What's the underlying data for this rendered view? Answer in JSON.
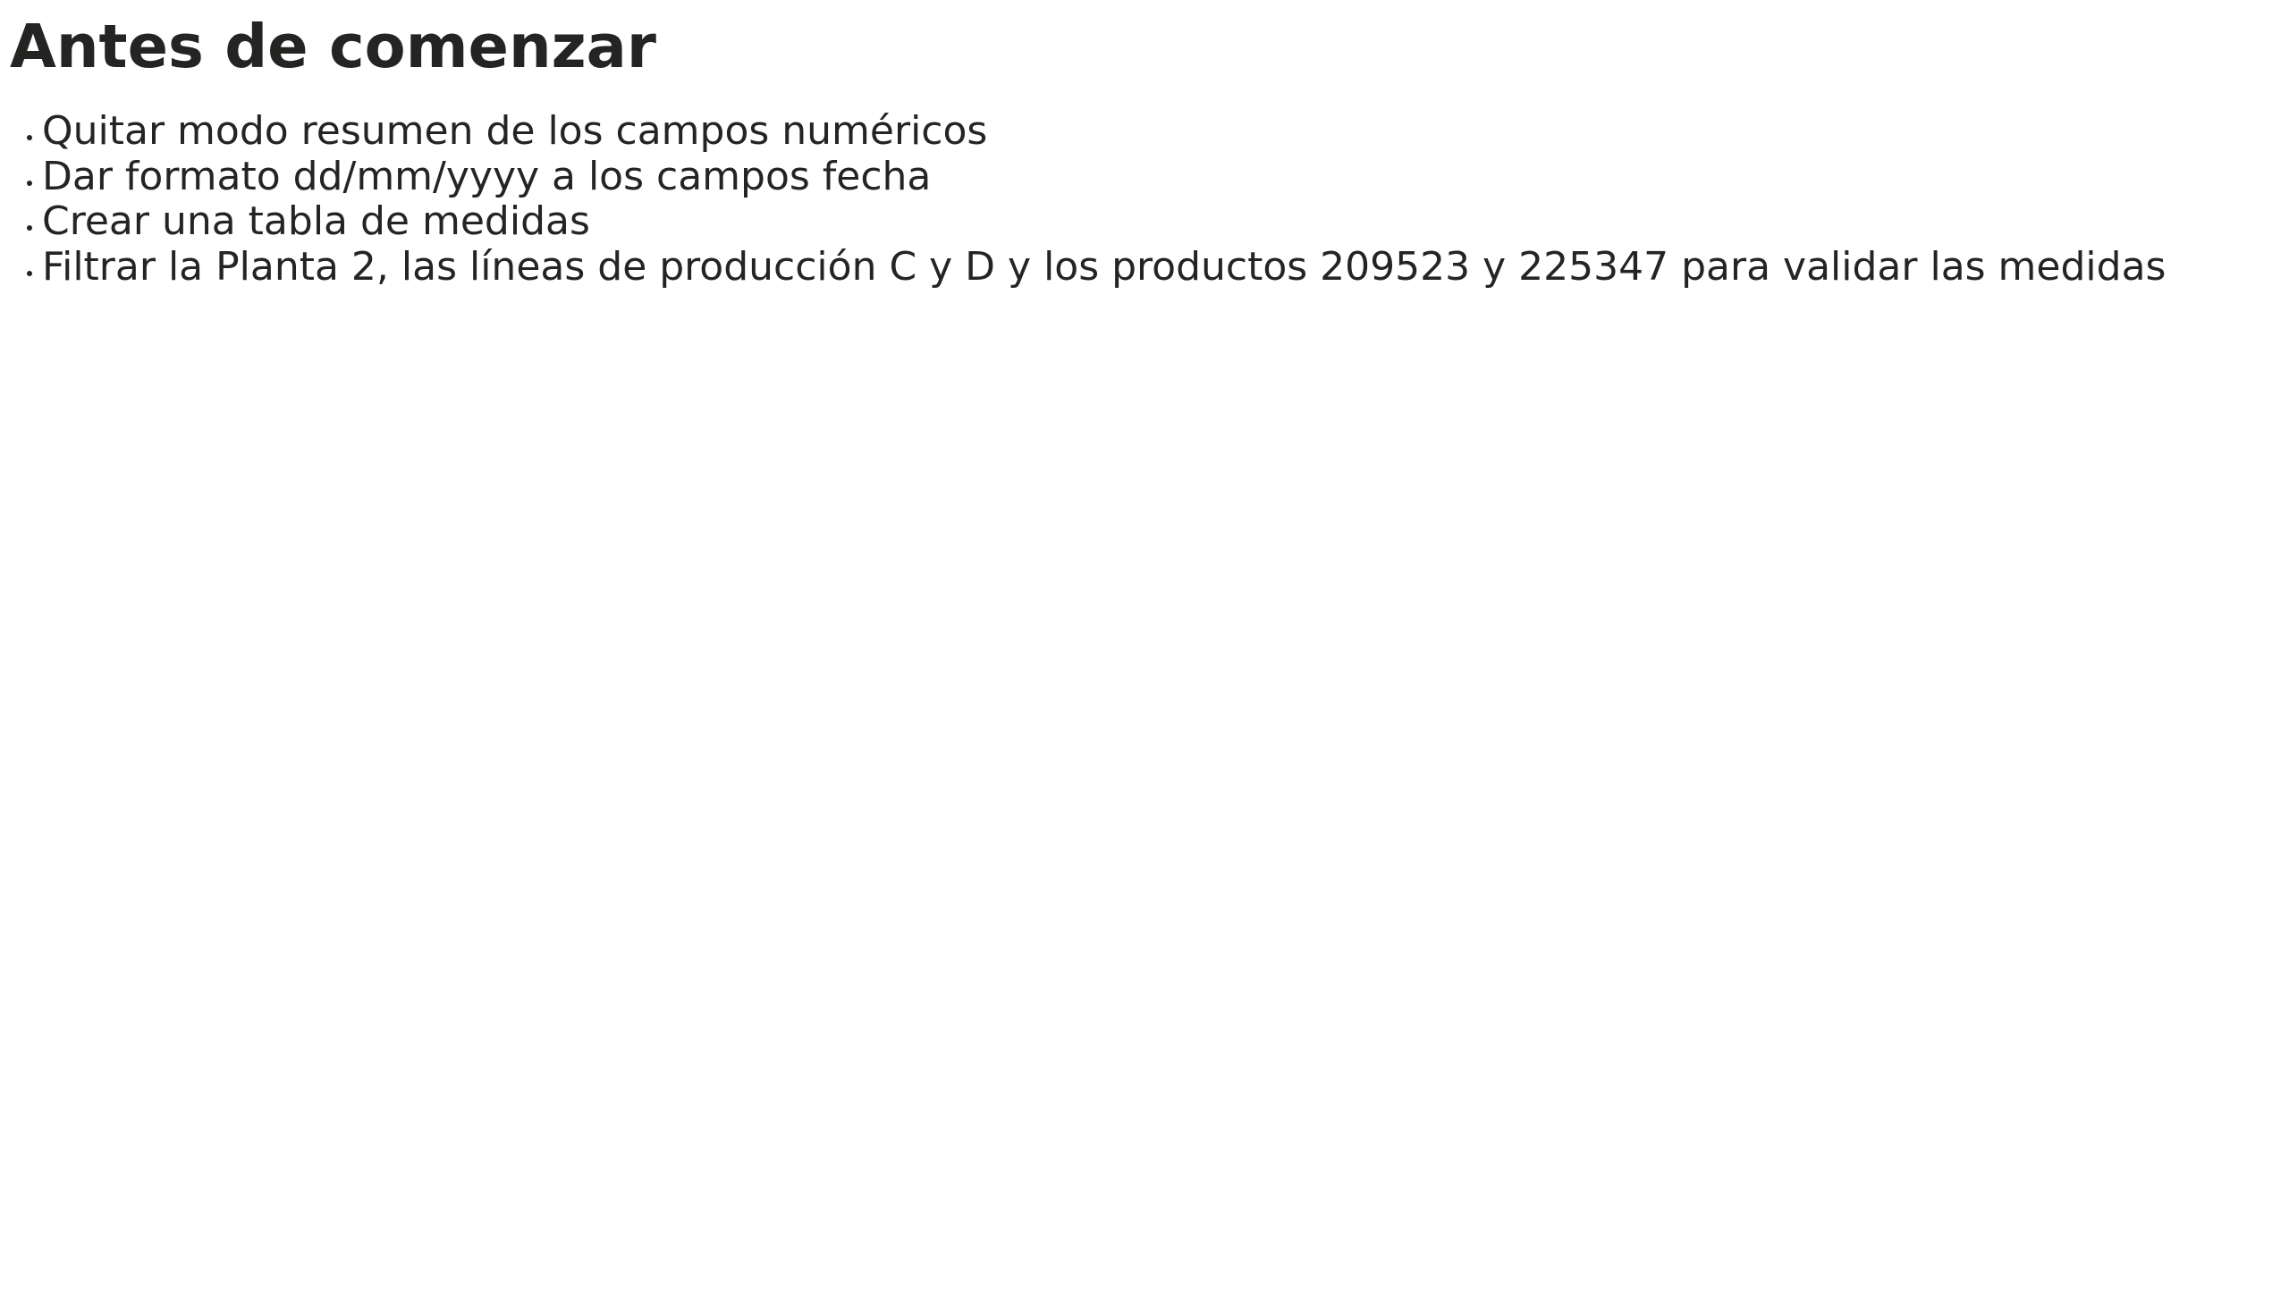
{
  "page": {
    "title": "Antes de comenzar",
    "text_color": "#252423",
    "background_color": "#ffffff"
  },
  "checklist": {
    "items": [
      {
        "label": "Quitar modo resumen de los campos numéricos"
      },
      {
        "label": "Dar formato dd/mm/yyyy a los campos fecha"
      },
      {
        "label": "Crear una tabla de medidas"
      },
      {
        "label": "Filtrar la Planta 2, las líneas de producción C y D y los productos 209523 y 225347 para validar las medidas"
      }
    ]
  }
}
